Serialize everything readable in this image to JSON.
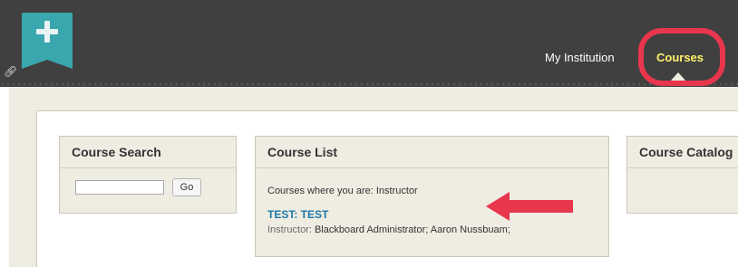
{
  "header": {
    "nav": {
      "my_institution": "My Institution",
      "courses": "Courses"
    },
    "active_tab": "Courses",
    "highlight_color": "#e8364d"
  },
  "modules": {
    "course_search": {
      "title": "Course Search",
      "input_value": "",
      "go_label": "Go"
    },
    "course_list": {
      "title": "Course List",
      "intro": "Courses where you are: Instructor",
      "courses": [
        {
          "name": "TEST: TEST",
          "instructor_label": "Instructor:",
          "instructors": "Blackboard Administrator;  Aaron Nussbuam;"
        }
      ]
    },
    "course_catalog": {
      "title": "Course Catalog"
    }
  },
  "icons": {
    "add": "plus-icon",
    "link": "link-icon",
    "annotation_arrow": "arrow-left-icon"
  },
  "colors": {
    "header_bg": "#404040",
    "add_tab": "#3aa6ae",
    "active_nav_text": "#fff36a",
    "link": "#1d78a9",
    "module_bg": "#efece2",
    "annotation": "#e8364d"
  }
}
